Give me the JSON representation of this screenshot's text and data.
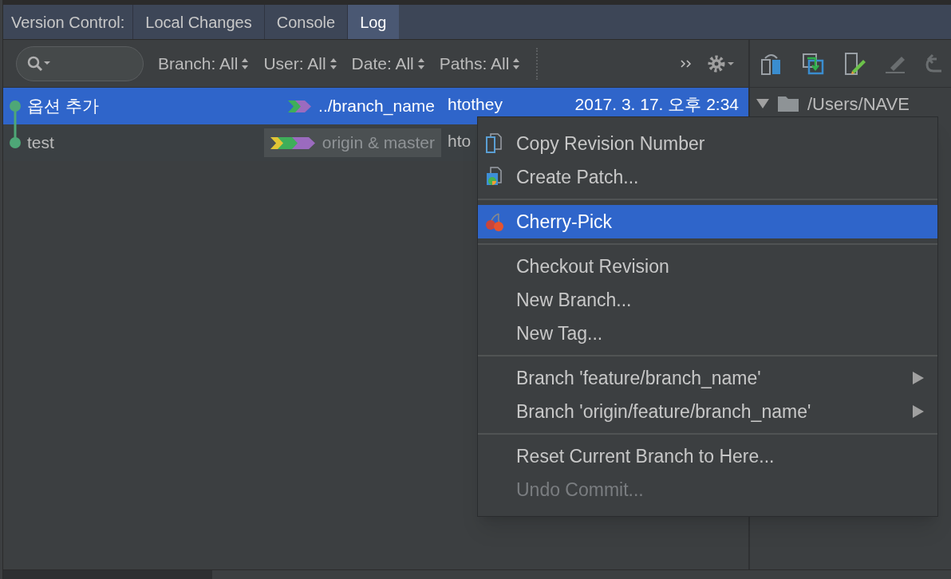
{
  "tool_window": {
    "title": "Version Control:",
    "tabs": [
      {
        "label": "Local Changes",
        "selected": false
      },
      {
        "label": "Console",
        "selected": false
      },
      {
        "label": "Log",
        "selected": true
      }
    ]
  },
  "filters": [
    "Branch: All",
    "User: All",
    "Date: All",
    "Paths: All"
  ],
  "commits": [
    {
      "subject": "옵션 추가",
      "refs": "../branch_name",
      "ref_highlighted": false,
      "tags": [
        {
          "color": "#3fae5a"
        },
        {
          "color": "#9b6bbf"
        }
      ],
      "author": "htothey",
      "date": "2017. 3. 17. 오후 2:34",
      "selected": true
    },
    {
      "subject": "test",
      "refs": "origin & master",
      "ref_highlighted": true,
      "tags": [
        {
          "color": "#e2c535"
        },
        {
          "color": "#3fae5a"
        },
        {
          "color": "#3fae5a"
        },
        {
          "color": "#9b6bbf"
        },
        {
          "color": "#9b6bbf"
        }
      ],
      "author": "hto",
      "selected": false
    }
  ],
  "details": {
    "path": "/Users/NAVE",
    "expanded": true
  },
  "context_menu": {
    "groups": [
      [
        {
          "label": "Copy Revision Number",
          "kind": "document",
          "selected": false,
          "disabled": false,
          "submenu": false
        },
        {
          "label": "Create Patch...",
          "kind": "patch",
          "selected": false,
          "disabled": false,
          "submenu": false
        }
      ],
      [
        {
          "label": "Cherry-Pick",
          "kind": "cherry",
          "selected": true,
          "disabled": false,
          "submenu": false
        }
      ],
      [
        {
          "label": "Checkout Revision",
          "selected": false,
          "disabled": false,
          "submenu": false
        },
        {
          "label": "New Branch...",
          "selected": false,
          "disabled": false,
          "submenu": false
        },
        {
          "label": "New Tag...",
          "selected": false,
          "disabled": false,
          "submenu": false
        }
      ],
      [
        {
          "label": "Branch 'feature/branch_name'",
          "selected": false,
          "disabled": false,
          "submenu": true
        },
        {
          "label": "Branch 'origin/feature/branch_name'",
          "selected": false,
          "disabled": false,
          "submenu": true
        }
      ],
      [
        {
          "label": "Reset Current Branch to Here...",
          "selected": false,
          "disabled": false,
          "submenu": false
        },
        {
          "label": "Undo Commit...",
          "selected": false,
          "disabled": true,
          "submenu": false
        }
      ]
    ]
  }
}
